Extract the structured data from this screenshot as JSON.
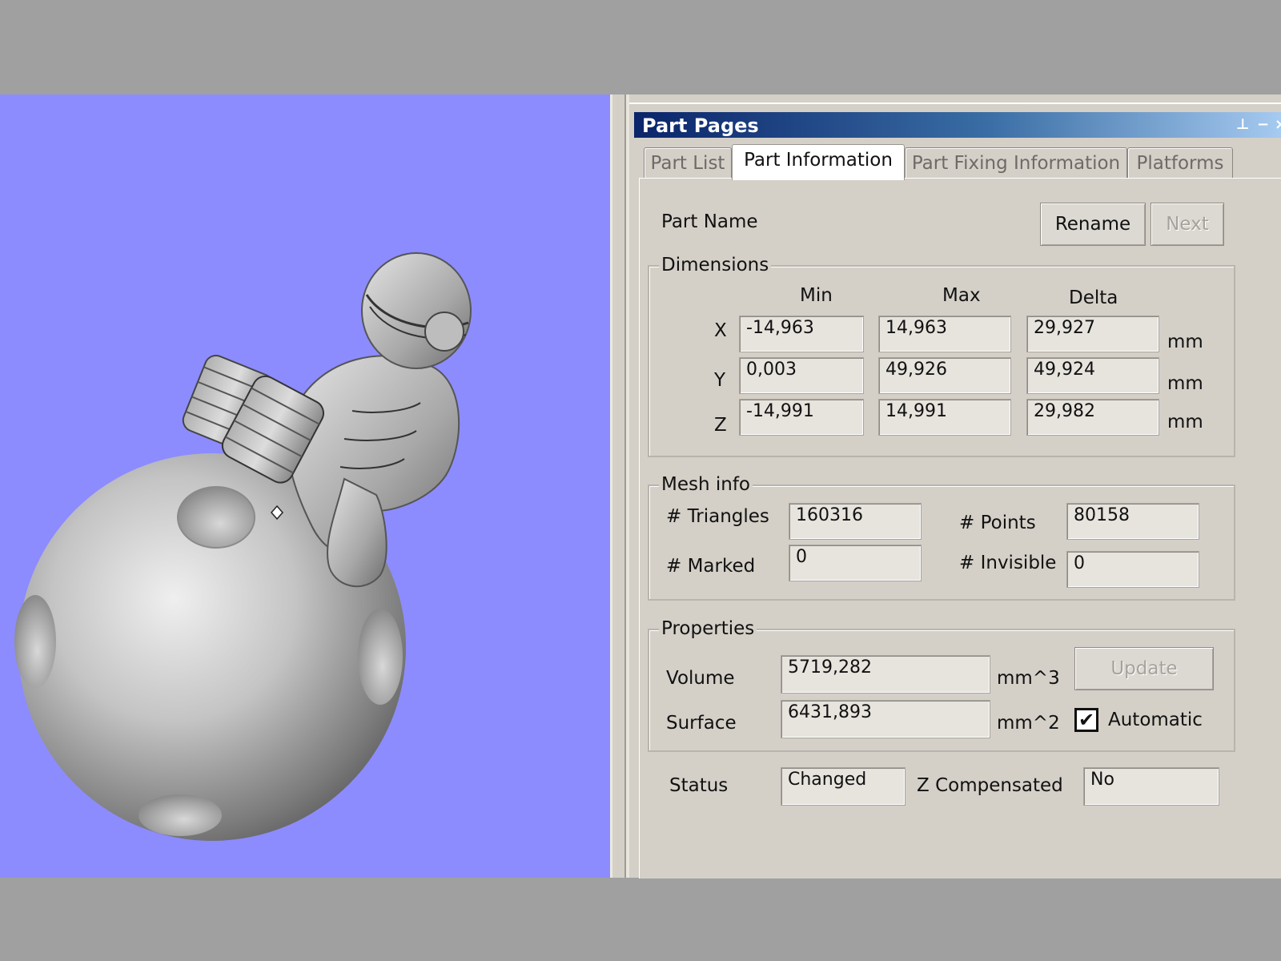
{
  "window": {
    "title": "Part Pages",
    "pin_icon": "pin-icon",
    "minimize_icon": "minimize-icon",
    "close_icon": "close-icon"
  },
  "tabs": [
    {
      "label": "Part List",
      "active": false
    },
    {
      "label": "Part Information",
      "active": true
    },
    {
      "label": "Part Fixing Information",
      "active": false
    },
    {
      "label": "Platforms",
      "active": false
    }
  ],
  "part": {
    "name_label": "Part Name",
    "rename_label": "Rename",
    "next_label": "Next"
  },
  "dimensions": {
    "title": "Dimensions",
    "headers": {
      "min": "Min",
      "max": "Max",
      "delta": "Delta"
    },
    "rows": [
      {
        "axis": "X",
        "min": "-14,963",
        "max": "14,963",
        "delta": "29,927",
        "unit": "mm"
      },
      {
        "axis": "Y",
        "min": "0,003",
        "max": "49,926",
        "delta": "49,924",
        "unit": "mm"
      },
      {
        "axis": "Z",
        "min": "-14,991",
        "max": "14,991",
        "delta": "29,982",
        "unit": "mm"
      }
    ]
  },
  "mesh": {
    "title": "Mesh info",
    "triangles_label": "# Triangles",
    "triangles": "160316",
    "points_label": "# Points",
    "points": "80158",
    "marked_label": "# Marked",
    "marked": "0",
    "invisible_label": "# Invisible",
    "invisible": "0"
  },
  "properties": {
    "title": "Properties",
    "volume_label": "Volume",
    "volume": "5719,282",
    "volume_unit": "mm^3",
    "surface_label": "Surface",
    "surface": "6431,893",
    "surface_unit": "mm^2",
    "update_label": "Update",
    "automatic_label": "Automatic",
    "automatic_checked": true,
    "check_mark": "✔"
  },
  "status": {
    "status_label": "Status",
    "status_value": "Changed",
    "zcomp_label": "Z Compensated",
    "zcomp_value": "No"
  },
  "colors": {
    "viewport_bg": "#8c8cff",
    "panel_bg": "#d4d0c8",
    "titlebar_start": "#0a246a",
    "titlebar_end": "#a6caf0",
    "outer_bg": "#a0a0a0"
  }
}
